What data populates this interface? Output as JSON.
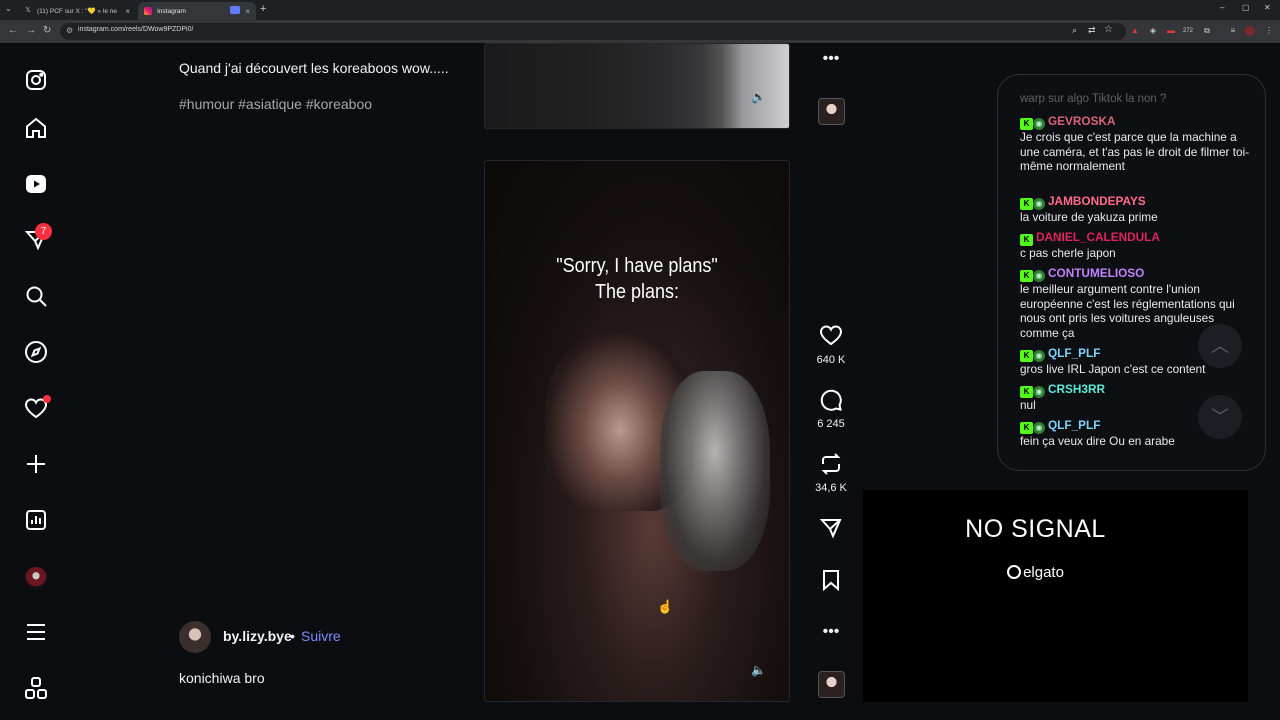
{
  "browser": {
    "tabs": [
      {
        "label": "(11) PCF sur X : \"💛 » le ne ev",
        "icon": "x-icon"
      },
      {
        "label": "Instagram",
        "icon": "instagram-icon"
      }
    ],
    "url": "instagram.com/reels/DWow9PZDPi0/",
    "extension_badge": "272"
  },
  "nav": {
    "notifications_badge": "7"
  },
  "post_top": {
    "caption": "Quand j'ai découvert les koreaboos wow.....",
    "hashtags": "#humour #asiatique #koreaboo"
  },
  "reel": {
    "overlay_line1": "\"Sorry, I have plans\"",
    "overlay_line2": "The plans:",
    "likes": "640 K",
    "comments": "6 245",
    "reposts": "34,6 K"
  },
  "post_bottom": {
    "author": "by.lizy.bye",
    "separator": "•",
    "follow": "Suivre",
    "caption": "konichiwa bro"
  },
  "chat": {
    "faded_line": "warp sur algo Tiktok la non ?",
    "messages": [
      {
        "user": "GEVROSKA",
        "color": "#d9637a",
        "text": "Je crois que c'est parce que la machine a une caméra, et t'as pas le droit de filmer toi-même normalement"
      },
      {
        "user": "JAMBONDEPAYS",
        "color": "#ff6b8a",
        "text": "la voiture de yakuza prime"
      },
      {
        "user": "DANIEL_CALENDULA",
        "color": "#e0245e",
        "text": "c pas cherle japon"
      },
      {
        "user": "CONTUMELIOSO",
        "color": "#c084fc",
        "text": "le meilleur argument contre l'union européenne c'est les réglementations qui nous ont pris les voitures anguleuses comme ça"
      },
      {
        "user": "QLF_PLF",
        "color": "#7dd3fc",
        "text": "gros live IRL Japon c'est ce content"
      },
      {
        "user": "CRSH3RR",
        "color": "#5eead4",
        "text": "nul"
      },
      {
        "user": "QLF_PLF",
        "color": "#7dd3fc",
        "text": "fein ça veux dire Ou en arabe"
      }
    ]
  },
  "capture": {
    "status": "NO SIGNAL",
    "brand": "elgato"
  }
}
